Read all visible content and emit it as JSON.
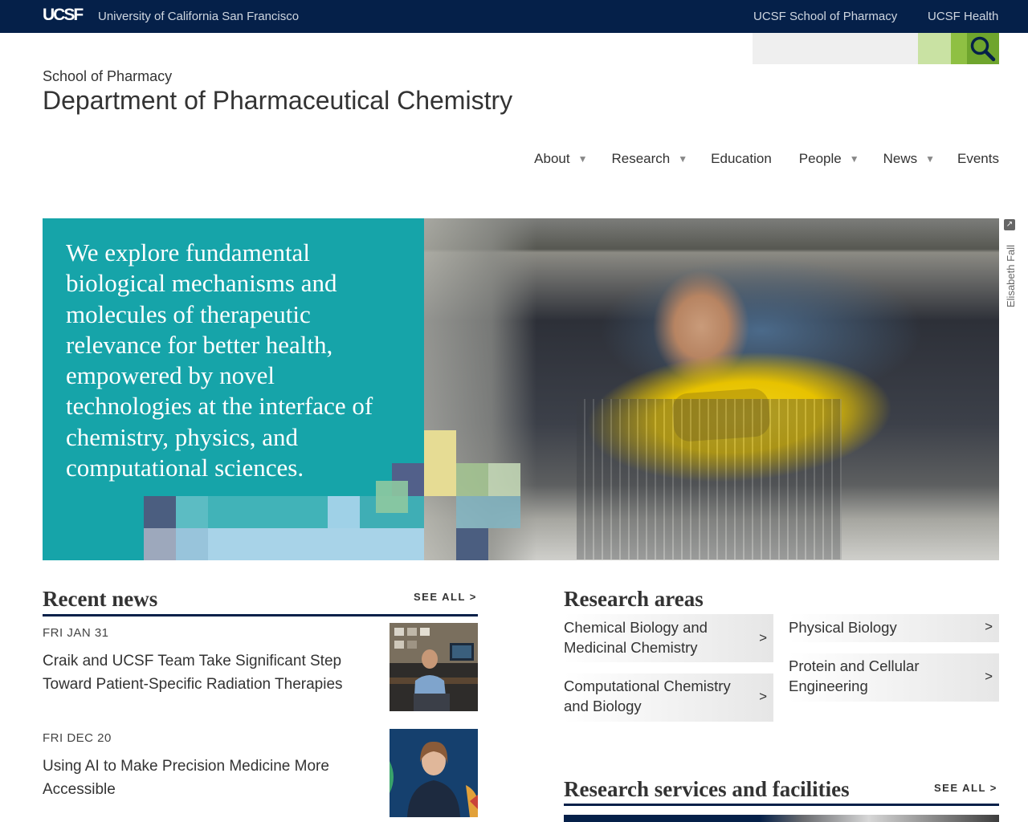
{
  "topbar": {
    "logo": "UCSF",
    "university": "University of California San Francisco",
    "links": [
      "UCSF School of Pharmacy",
      "UCSF Health"
    ]
  },
  "search": {
    "placeholder": "",
    "icon": "search-icon"
  },
  "header": {
    "school": "School of Pharmacy",
    "department": "Department of Pharmaceutical Chemistry"
  },
  "nav": {
    "items": [
      {
        "label": "About",
        "dropdown": true
      },
      {
        "label": "Research",
        "dropdown": true
      },
      {
        "label": "Education",
        "dropdown": false
      },
      {
        "label": "People",
        "dropdown": true
      },
      {
        "label": "News",
        "dropdown": true
      },
      {
        "label": "Events",
        "dropdown": false
      }
    ],
    "caret": "▼"
  },
  "hero": {
    "text": "We explore fundamental biological mechanisms and molecules of therapeutic relevance for better health, empowered by novel technologies at the interface of chemistry, physics, and computational sciences.",
    "photo_credit": "Elisabeth Fall",
    "credit_icon": "↗",
    "panel_color": "#16a4a9"
  },
  "recent_news": {
    "title": "Recent news",
    "see_all": "SEE ALL >",
    "items": [
      {
        "date": "FRI JAN 31",
        "title": "Craik and UCSF Team Take Significant Step Toward Patient-Specific Radiation Therapies"
      },
      {
        "date": "FRI DEC 20",
        "title": "Using AI to Make Precision Medicine More Accessible"
      }
    ]
  },
  "research_areas": {
    "title": "Research areas",
    "chevron": ">",
    "items": [
      {
        "label": "Chemical Biology and Medicinal Chemistry"
      },
      {
        "label": "Computational Chemistry and Biology"
      },
      {
        "label": "Physical Biology"
      },
      {
        "label": "Protein and Cellular Engineering"
      }
    ]
  },
  "research_services": {
    "title": "Research services and facilities",
    "see_all": "SEE ALL >"
  },
  "colors": {
    "navy": "#052049",
    "teal": "#16a4a9",
    "search_green": "#6fa52d"
  }
}
